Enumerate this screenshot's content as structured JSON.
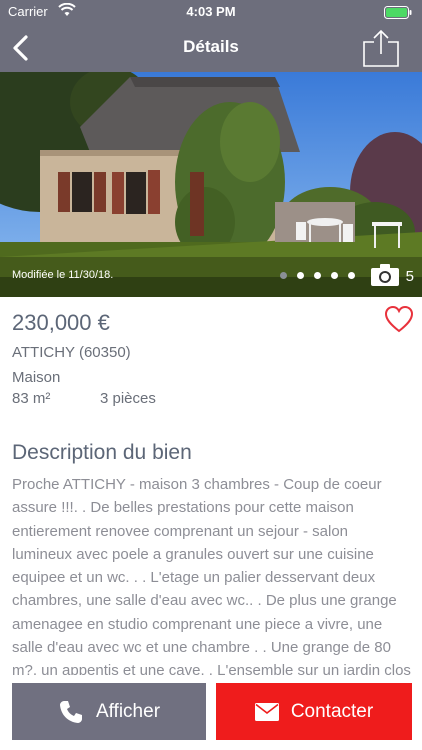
{
  "status_bar": {
    "carrier": "Carrier",
    "time": "4:03 PM"
  },
  "nav": {
    "title": "Détails"
  },
  "photo": {
    "modified_label": "Modifiée le 11/30/18.",
    "photo_count": "5",
    "total_dots": 5,
    "active_dot": 1
  },
  "listing": {
    "price": "230,000 €",
    "city": "ATTICHY (60350)",
    "property_type": "Maison",
    "area": "83 m²",
    "rooms": "3 pièces"
  },
  "description": {
    "title": "Description du bien",
    "text": "Proche ATTICHY - maison 3 chambres - Coup de coeur assure !!!. . De belles prestations pour cette maison entierement renovee comprenant un sejour - salon lumineux avec poele a granules ouvert sur une cuisine equipee et un wc. . . L'etage un palier desservant deux chambres, une salle d'eau avec wc.. . De plus une grange amenagee en studio comprenant une piece a vivre, une salle d'eau avec wc et une chambre . . Une grange de 80 m?, un appentis et une cave. . L'ensemble sur un jardin clos sans vis a vis de"
  },
  "actions": {
    "afficher_label": "Afficher",
    "contacter_label": "Contacter"
  },
  "colors": {
    "nav_bar": "#6d6e7c",
    "afficher_button": "#707080",
    "contacter_button": "#ef1c1c",
    "heart": "#e8323c"
  },
  "icons": [
    "wifi-icon",
    "battery-icon",
    "back-chevron-icon",
    "share-icon",
    "camera-icon",
    "heart-icon",
    "phone-icon",
    "envelope-icon"
  ]
}
